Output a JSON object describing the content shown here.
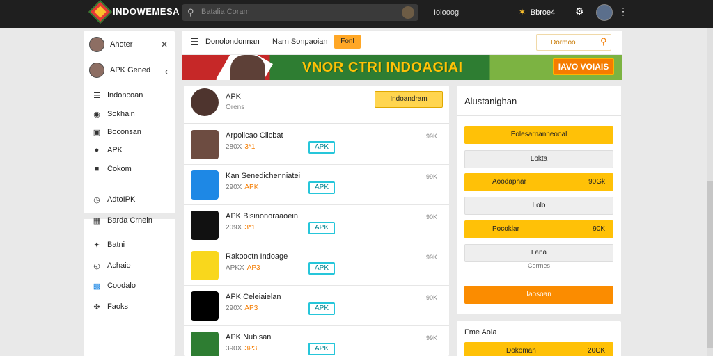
{
  "topbar": {
    "brand": "INDOWEMESA",
    "search_placeholder": "Batalia Coram",
    "center_link": "Iolooog",
    "right_text": "Bbroe4",
    "colors": {
      "bar": "#1f1f1f",
      "accent": "#fbc02d"
    }
  },
  "sidebar": {
    "user": "Ahoter",
    "section_title": "APK Gened",
    "items": [
      {
        "icon": "list-icon",
        "label": "Indoncoan"
      },
      {
        "icon": "circle-icon",
        "label": "Sokhain"
      },
      {
        "icon": "folder-icon",
        "label": "Boconsan"
      },
      {
        "icon": "tag-icon",
        "label": "APK"
      },
      {
        "icon": "square-icon",
        "label": "Cokom"
      }
    ],
    "lower_items": [
      {
        "icon": "clock-icon",
        "label": "AdtoIPK"
      },
      {
        "icon": "grid-icon",
        "label": "Barda Crnein"
      },
      {
        "icon": "pin-icon",
        "label": "Batni"
      },
      {
        "icon": "calendar-icon",
        "label": "Achaio"
      },
      {
        "icon": "doc-icon",
        "label": "Coodalo"
      },
      {
        "icon": "share-icon",
        "label": "Faoks"
      }
    ]
  },
  "toolbar": {
    "link1": "Donolondonnan",
    "link2": "Narn Sonpaoian",
    "font_btn": "Fonl",
    "right_btn": "Dormoo"
  },
  "banner": {
    "title": "VNOR CTRI INDOAGIAI",
    "button": "IAVO VOIAIS"
  },
  "list": {
    "header": {
      "title": "APK",
      "sub": "Orens",
      "button": "Indoandram"
    },
    "rows": [
      {
        "title": "Arpolicao Ciicbat",
        "meta": "280X",
        "tag": "3*1",
        "badge": "APK",
        "size": "99K",
        "color": "#6d4c41"
      },
      {
        "title": "Kan Senedichenniatei",
        "meta": "290X",
        "tag": "APK",
        "badge": "APK",
        "size": "99K",
        "color": "#1e88e5"
      },
      {
        "title": "APK Bisinonoraaoein",
        "meta": "209X",
        "tag": "3*1",
        "badge": "APK",
        "size": "90K",
        "color": "#111111"
      },
      {
        "title": "Rakooctn Indoage",
        "meta": "APKX",
        "tag": "AP3",
        "badge": "APK",
        "size": "99K",
        "color": "#f9d71c"
      },
      {
        "title": "APK Celeiaielan",
        "meta": "290X",
        "tag": "AP3",
        "badge": "APK",
        "size": "90K",
        "color": "#000000"
      },
      {
        "title": "APK Nubisan",
        "meta": "390X",
        "tag": "3P3",
        "badge": "APK",
        "size": "99K",
        "color": "#2e7d32"
      }
    ]
  },
  "panel": {
    "title": "Alustanighan",
    "buttons": [
      {
        "label": "Eolesarnanneooal",
        "value": "",
        "style": "y"
      },
      {
        "label": "Lokta",
        "value": "",
        "style": "g"
      },
      {
        "label": "Aoodaphar",
        "value": "90Gk",
        "style": "y"
      },
      {
        "label": "Lolo",
        "value": "",
        "style": "g"
      },
      {
        "label": "Pocoklar",
        "value": "90K",
        "style": "y"
      },
      {
        "label": "Lana",
        "value": "",
        "style": "g"
      }
    ],
    "caption": "Corrnes",
    "cta": "Iaosoan"
  },
  "panel2": {
    "title": "Fme Aola",
    "button": "Dokoman",
    "value": "20ЄK"
  }
}
